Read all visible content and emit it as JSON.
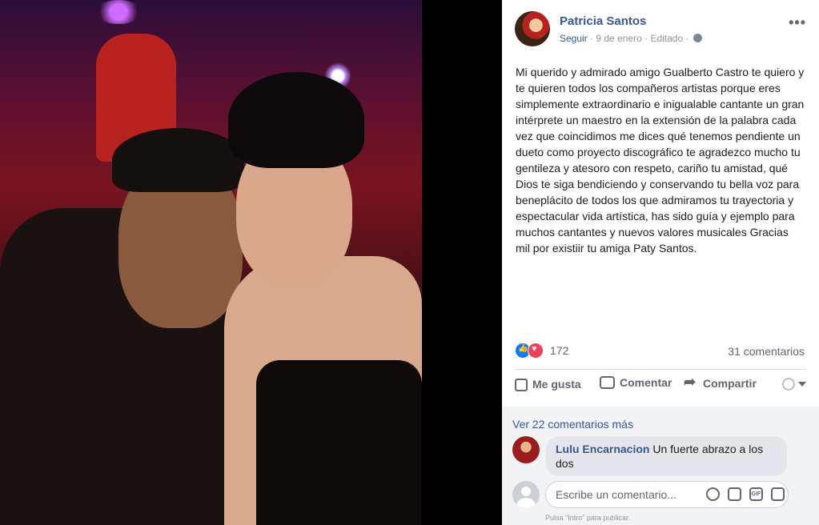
{
  "post": {
    "author": "Patricia Santos",
    "follow": "Seguir",
    "date": "9 de enero",
    "edited": "Editado",
    "separator": "·",
    "more": "•••",
    "text": "Mi querido y admirado amigo Gualberto Castro te quiero y te quieren todos los compañeros artistas porque eres simplemente extraordinario e inigualable cantante un gran intérprete un maestro en la extensión de la palabra cada vez que coincidimos me dices qué tenemos pendiente un dueto como proyecto discográfico te agradezco mucho tu gentileza y atesoro con respeto, cariño tu amistad, qué Dios te siga bendiciendo y conservando tu bella voz para beneplácito de todos los que admiramos tu trayectoria y espectacular vida artística, has sido guía y ejemplo para muchos cantantes y nuevos valores musicales Gracias mil por existiir tu amiga Paty Santos."
  },
  "reactions": {
    "count": "172",
    "comments_count": "31 comentarios",
    "types": [
      "like-icon",
      "love-icon"
    ],
    "colors": {
      "like": "#1877f2",
      "love": "#f33e58"
    }
  },
  "actions": {
    "like": "Me gusta",
    "comment": "Comentar",
    "share": "Compartir"
  },
  "comments": {
    "view_more": "Ver 22 comentarios más",
    "items": [
      {
        "author": "Lulu Encarnacion",
        "text": "Un fuerte abrazo a los dos"
      }
    ],
    "composer": {
      "placeholder": "Escribe un comentario...",
      "gif": "GIF",
      "hint": "Pulsa \"Intro\" para publicar."
    }
  },
  "colors": {
    "link": "#385898",
    "text": "#1c1e21",
    "muted": "#90949c",
    "background_panel": "#f2f3f5"
  }
}
